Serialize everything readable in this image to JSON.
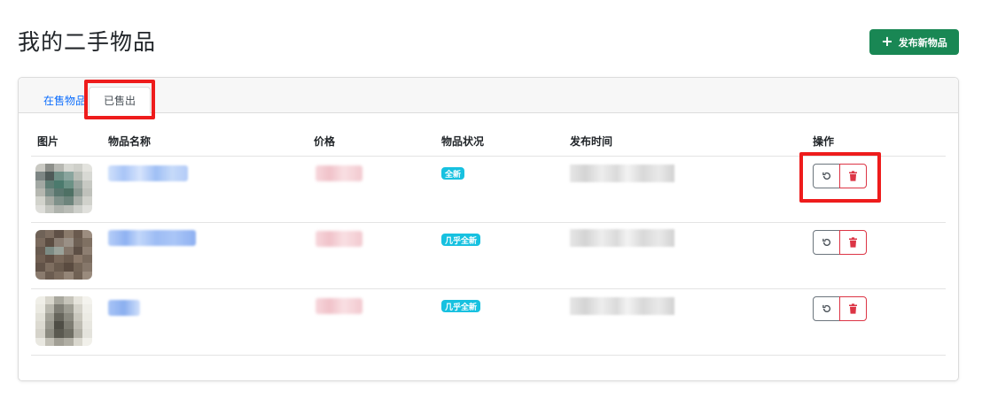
{
  "header": {
    "title": "我的二手物品",
    "publish_label": "发布新物品",
    "publish_icon": "plus-icon"
  },
  "tabs": [
    {
      "label": "在售物品",
      "active": false
    },
    {
      "label": "已售出",
      "active": true
    }
  ],
  "table": {
    "columns": [
      "图片",
      "物品名称",
      "价格",
      "物品状况",
      "发布时间",
      "操作"
    ],
    "rows": [
      {
        "condition": "全新",
        "actions": [
          "restore-icon",
          "trash-icon"
        ]
      },
      {
        "condition": "几乎全新",
        "actions": [
          "restore-icon",
          "trash-icon"
        ]
      },
      {
        "condition": "几乎全新",
        "actions": [
          "restore-icon",
          "trash-icon"
        ]
      }
    ]
  },
  "colors": {
    "primary_green": "#198754",
    "link_blue": "#0d6efd",
    "badge_cyan": "#17c1e0",
    "danger_red": "#dc3545",
    "highlight_red": "#ee1c1c"
  }
}
